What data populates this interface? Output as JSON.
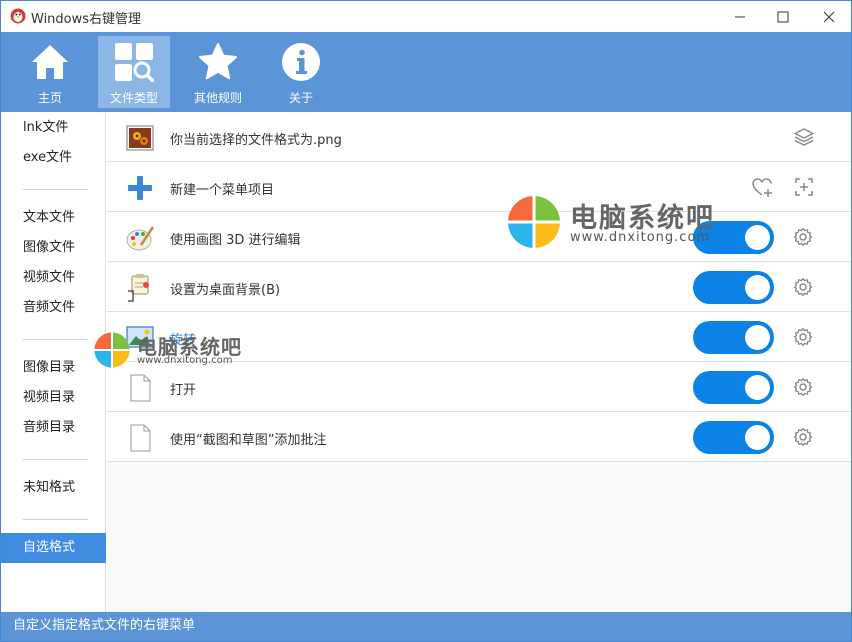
{
  "window": {
    "title": "Windows右键管理",
    "minimize_icon": "minimize-icon",
    "maximize_icon": "maximize-icon",
    "close_icon": "close-icon"
  },
  "toolbar": {
    "items": [
      {
        "label": "主页",
        "icon": "home-icon",
        "active": false
      },
      {
        "label": "文件类型",
        "icon": "file-types-icon",
        "active": true
      },
      {
        "label": "其他规则",
        "icon": "star-icon",
        "active": false
      },
      {
        "label": "关于",
        "icon": "info-icon",
        "active": false
      }
    ]
  },
  "sidebar": {
    "items": [
      {
        "label": "lnk文件"
      },
      {
        "label": "exe文件"
      },
      {
        "label": "文本文件"
      },
      {
        "label": "图像文件"
      },
      {
        "label": "视频文件"
      },
      {
        "label": "音频文件"
      },
      {
        "label": "图像目录"
      },
      {
        "label": "视频目录"
      },
      {
        "label": "音频目录"
      },
      {
        "label": "未知格式"
      },
      {
        "label": "自选格式",
        "active": true
      }
    ]
  },
  "main": {
    "rows": [
      {
        "label": "你当前选择的文件格式为.png",
        "icon": "image-file-icon",
        "right_icon": "layers-icon"
      },
      {
        "label": "新建一个菜单项目",
        "icon": "plus-icon",
        "right_icons": [
          "favorite-add-icon",
          "add-item-icon"
        ]
      },
      {
        "label": "使用画图 3D 进行编辑",
        "icon": "paint-palette-icon",
        "toggle": true
      },
      {
        "label": "设置为桌面背景(B)",
        "icon": "wallpaper-plug-icon",
        "toggle": true
      },
      {
        "label": "旋转",
        "icon": "rotate-image-icon",
        "toggle": true
      },
      {
        "label": "打开",
        "icon": "blank-file-icon",
        "toggle": true
      },
      {
        "label": "使用“截图和草图”添加批注",
        "icon": "blank-file-icon",
        "toggle": true
      }
    ]
  },
  "watermarks": [
    {
      "title": "电脑系统吧",
      "url": "www.dnxitong.com"
    },
    {
      "title": "电脑系统吧",
      "url": "www.dnxitong.com"
    }
  ],
  "statusbar": {
    "text": "自定义指定格式文件的右键菜单"
  },
  "colors": {
    "accent": "#5b95d8",
    "toggle_on": "#0b82e6",
    "sidebar_active": "#3f8ce0"
  }
}
